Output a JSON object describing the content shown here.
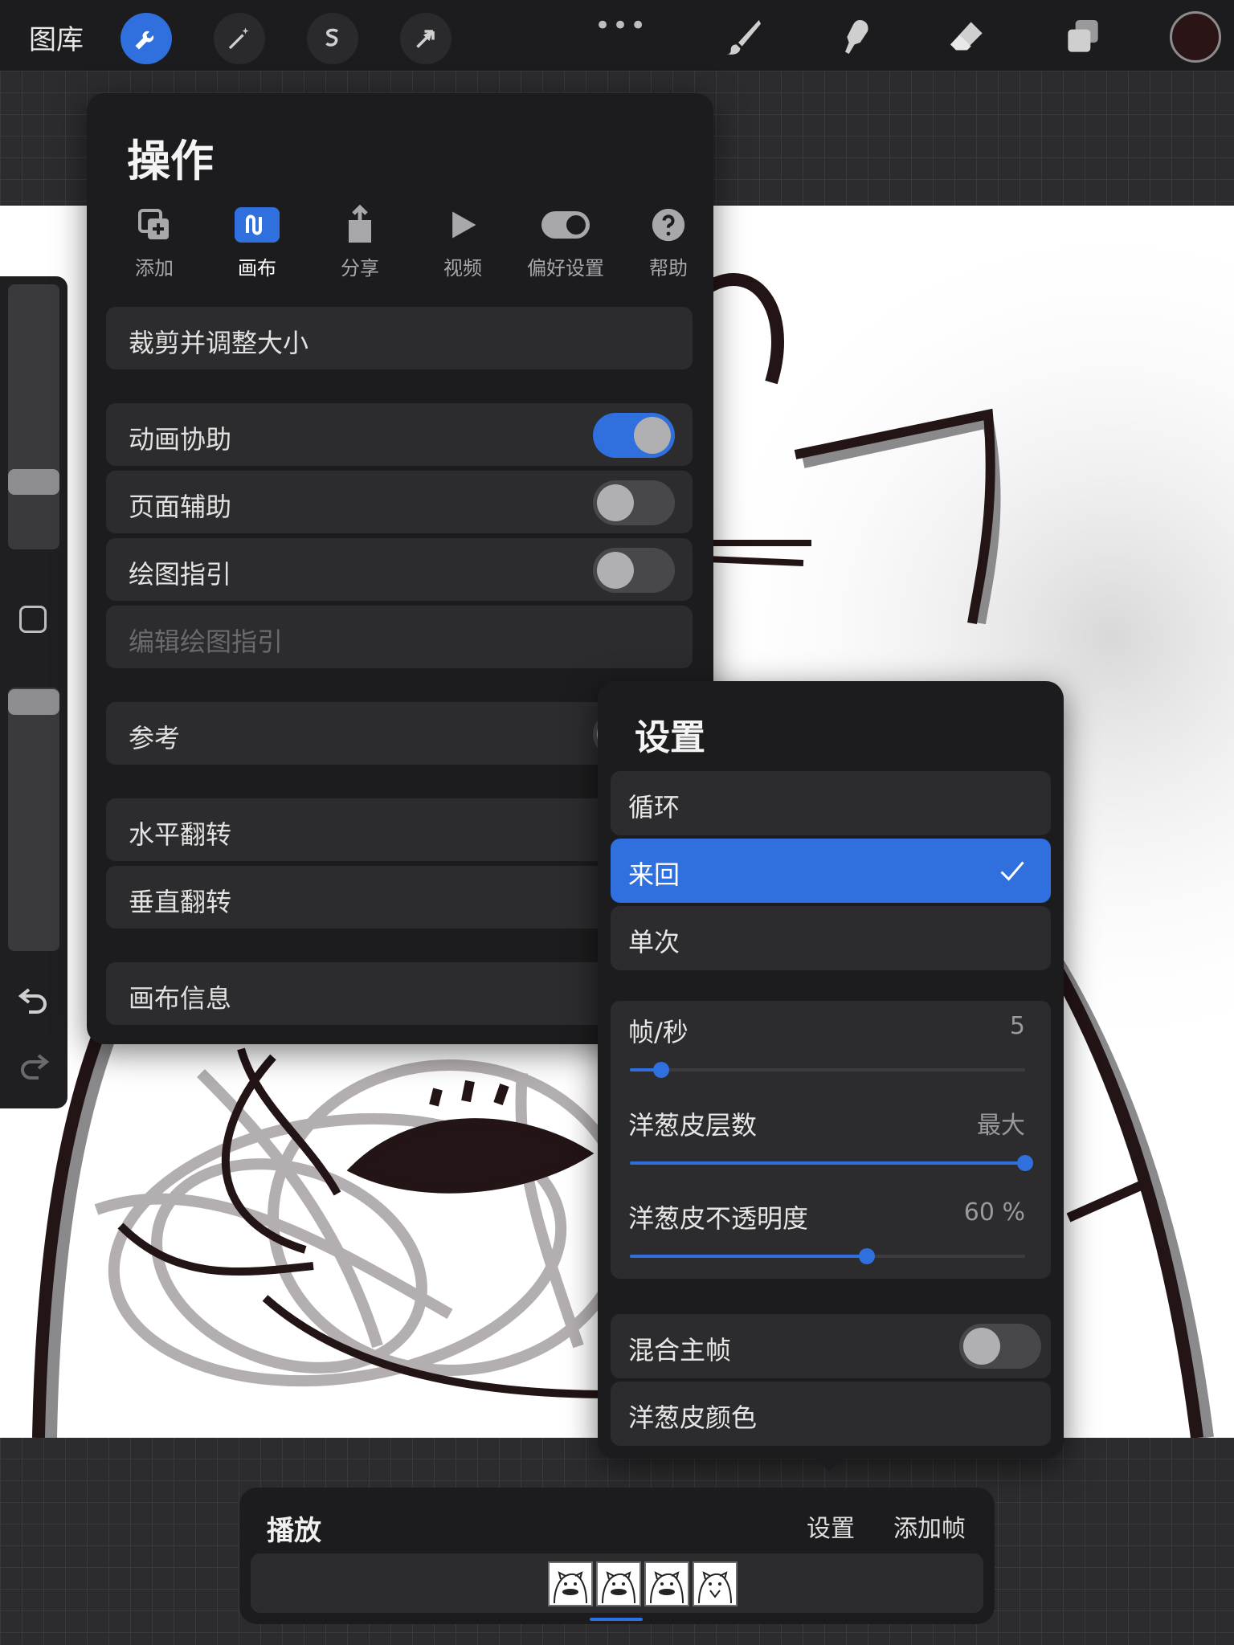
{
  "topbar": {
    "gallery_label": "图库",
    "more_label": "•••",
    "tools_left": [
      "wrench-icon",
      "magic-wand-icon",
      "selection-icon",
      "transform-arrow-icon"
    ],
    "tools_right": [
      "brush-icon",
      "smudge-icon",
      "eraser-icon",
      "layers-icon"
    ],
    "current_color": "#2a1416"
  },
  "actions": {
    "title": "操作",
    "tabs": [
      {
        "label": "添加",
        "icon": "add-layer-icon"
      },
      {
        "label": "画布",
        "icon": "canvas-icon",
        "active": true
      },
      {
        "label": "分享",
        "icon": "share-icon"
      },
      {
        "label": "视频",
        "icon": "play-icon"
      },
      {
        "label": "偏好设置",
        "icon": "toggle-icon"
      },
      {
        "label": "帮助",
        "icon": "help-icon"
      }
    ],
    "crop_resize": "裁剪并调整大小",
    "animation_assist": "动画协助",
    "page_assist": "页面辅助",
    "drawing_guide": "绘图指引",
    "edit_drawing_guide": "编辑绘图指引",
    "reference": "参考",
    "flip_horizontal": "水平翻转",
    "flip_vertical": "垂直翻转",
    "canvas_info": "画布信息"
  },
  "settings": {
    "title": "设置",
    "loop": "循环",
    "ping_pong": "来回",
    "one_shot": "单次",
    "selected_mode": "来回",
    "fps_label": "帧/秒",
    "fps_value": "5",
    "fps_fraction": 0.08,
    "onion_layers_label": "洋葱皮层数",
    "onion_layers_value": "最大",
    "onion_layers_fraction": 1.0,
    "onion_opacity_label": "洋葱皮不透明度",
    "onion_opacity_value": "60 %",
    "onion_opacity_fraction": 0.6,
    "blend_primary": "混合主帧",
    "onion_color": "洋葱皮颜色"
  },
  "playback": {
    "title": "播放",
    "settings_label": "设置",
    "add_frame_label": "添加帧",
    "frame_count": 4
  },
  "colors": {
    "accent": "#2f6fde",
    "panel": "#1c1c1e",
    "row": "#2c2c2e"
  }
}
